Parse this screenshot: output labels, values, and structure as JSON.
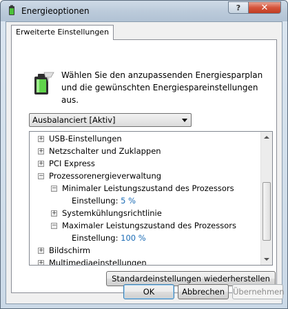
{
  "window": {
    "title": "Energieoptionen",
    "help_glyph": "?",
    "close_glyph": "✕"
  },
  "tabs": [
    {
      "label": "Erweiterte Einstellungen"
    }
  ],
  "description": "Wählen Sie den anzupassenden Energiesparplan und die gewünschten Energiespareinstellungen aus.",
  "plan_select": {
    "value": "Ausbalanciert [Aktiv]"
  },
  "tree": {
    "items": [
      {
        "label": "USB-Einstellungen",
        "expander": "+"
      },
      {
        "label": "Netzschalter und Zuklappen",
        "expander": "+"
      },
      {
        "label": "PCI Express",
        "expander": "+"
      },
      {
        "label": "Prozessorenergieverwaltung",
        "expander": "−"
      },
      {
        "label": "Minimaler Leistungszustand des Prozessors",
        "expander": "−"
      },
      {
        "label": "Einstellung:",
        "value": "5 %"
      },
      {
        "label": "Systemkühlungsrichtlinie",
        "expander": "+"
      },
      {
        "label": "Maximaler Leistungszustand des Prozessors",
        "expander": "−"
      },
      {
        "label": "Einstellung:",
        "value": "100 %"
      },
      {
        "label": "Bildschirm",
        "expander": "+"
      },
      {
        "label": "Multimediaeinstellungen",
        "expander": "+"
      }
    ]
  },
  "buttons": {
    "restore": "Standardeinstellungen wiederherstellen",
    "ok": "OK",
    "cancel": "Abbrechen",
    "apply": "Übernehmen"
  }
}
